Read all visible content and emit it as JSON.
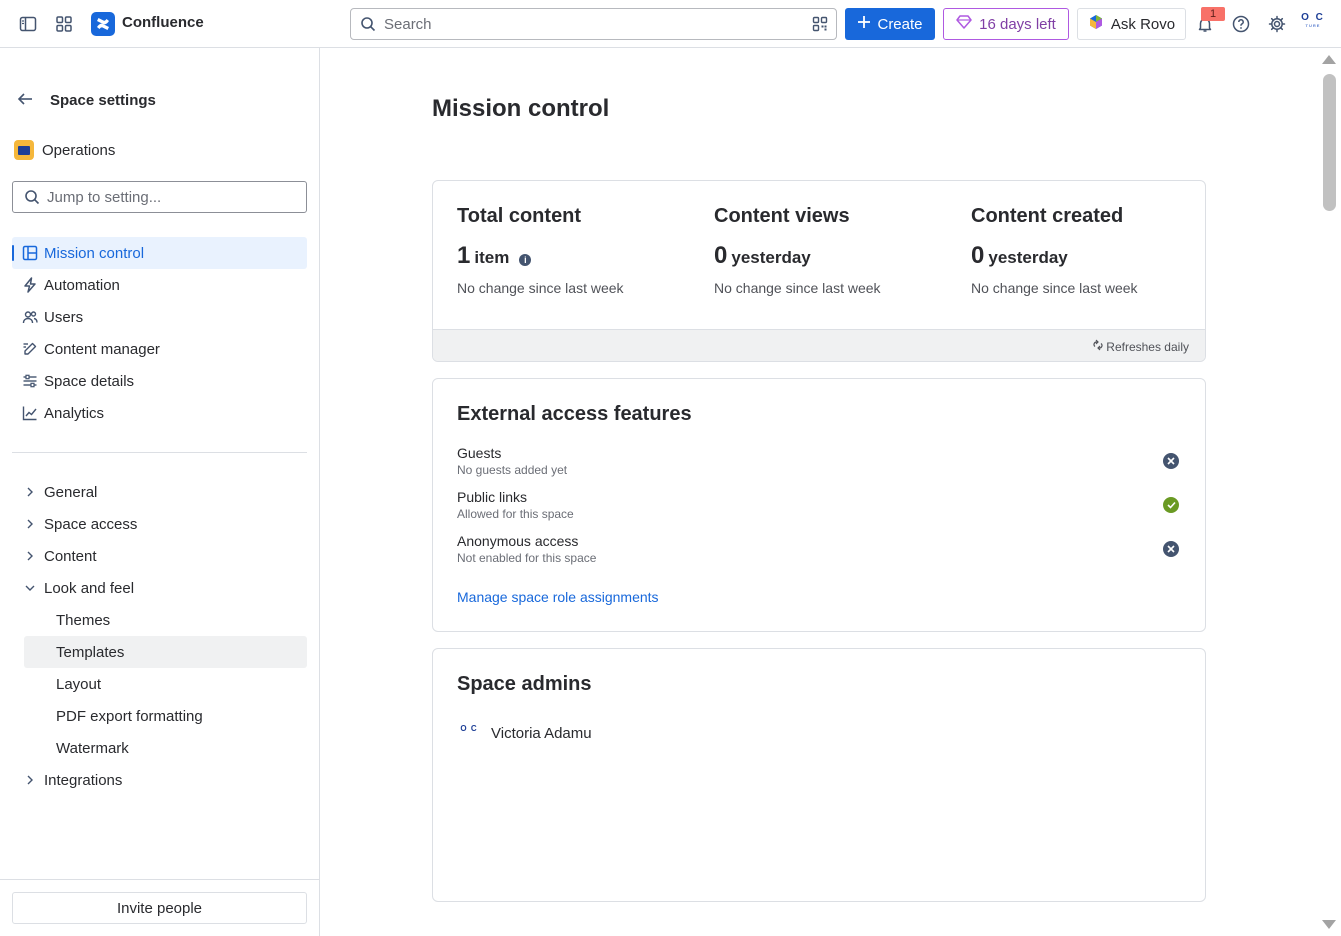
{
  "topbar": {
    "brand": "Confluence",
    "search_placeholder": "Search",
    "create_label": "Create",
    "trial_label": "16 days left",
    "rovo_label": "Ask Rovo",
    "notification_count": "1",
    "avatar_initials": "O C",
    "avatar_sub": "TURE"
  },
  "sidebar": {
    "title": "Space settings",
    "space_name": "Operations",
    "jump_placeholder": "Jump to setting...",
    "primary_items": [
      {
        "label": "Mission control",
        "icon": "layout-icon",
        "active": true
      },
      {
        "label": "Automation",
        "icon": "lightning-icon"
      },
      {
        "label": "Users",
        "icon": "people-icon"
      },
      {
        "label": "Content manager",
        "icon": "edit-icon"
      },
      {
        "label": "Space details",
        "icon": "sliders-icon"
      },
      {
        "label": "Analytics",
        "icon": "chart-line-icon"
      }
    ],
    "sections": [
      {
        "label": "General",
        "expanded": false
      },
      {
        "label": "Space access",
        "expanded": false
      },
      {
        "label": "Content",
        "expanded": false
      },
      {
        "label": "Look and feel",
        "expanded": true
      },
      {
        "label": "Integrations",
        "expanded": false
      }
    ],
    "look_and_feel_items": [
      "Themes",
      "Templates",
      "Layout",
      "PDF export formatting",
      "Watermark"
    ],
    "invite_label": "Invite people"
  },
  "main": {
    "title": "Mission control",
    "stats": [
      {
        "heading": "Total content",
        "value": "1",
        "unit": "item",
        "change": "No change since last week"
      },
      {
        "heading": "Content views",
        "value": "0",
        "unit": "yesterday",
        "change": "No change since last week"
      },
      {
        "heading": "Content created",
        "value": "0",
        "unit": "yesterday",
        "change": "No change since last week"
      }
    ],
    "refresh_label": "Refreshes daily",
    "external_access": {
      "heading": "External access features",
      "features": [
        {
          "name": "Guests",
          "desc": "No guests added yet",
          "status": "off"
        },
        {
          "name": "Public links",
          "desc": "Allowed for this space",
          "status": "on"
        },
        {
          "name": "Anonymous access",
          "desc": "Not enabled for this space",
          "status": "off"
        }
      ],
      "link_label": "Manage space role assignments"
    },
    "admins": {
      "heading": "Space admins",
      "people": [
        {
          "name": "Victoria Adamu",
          "initials": "O C"
        }
      ]
    }
  },
  "colors": {
    "accent": "#1868db",
    "trial": "#af59e1",
    "status_on": "#6a9a23",
    "status_off": "#44546f"
  }
}
